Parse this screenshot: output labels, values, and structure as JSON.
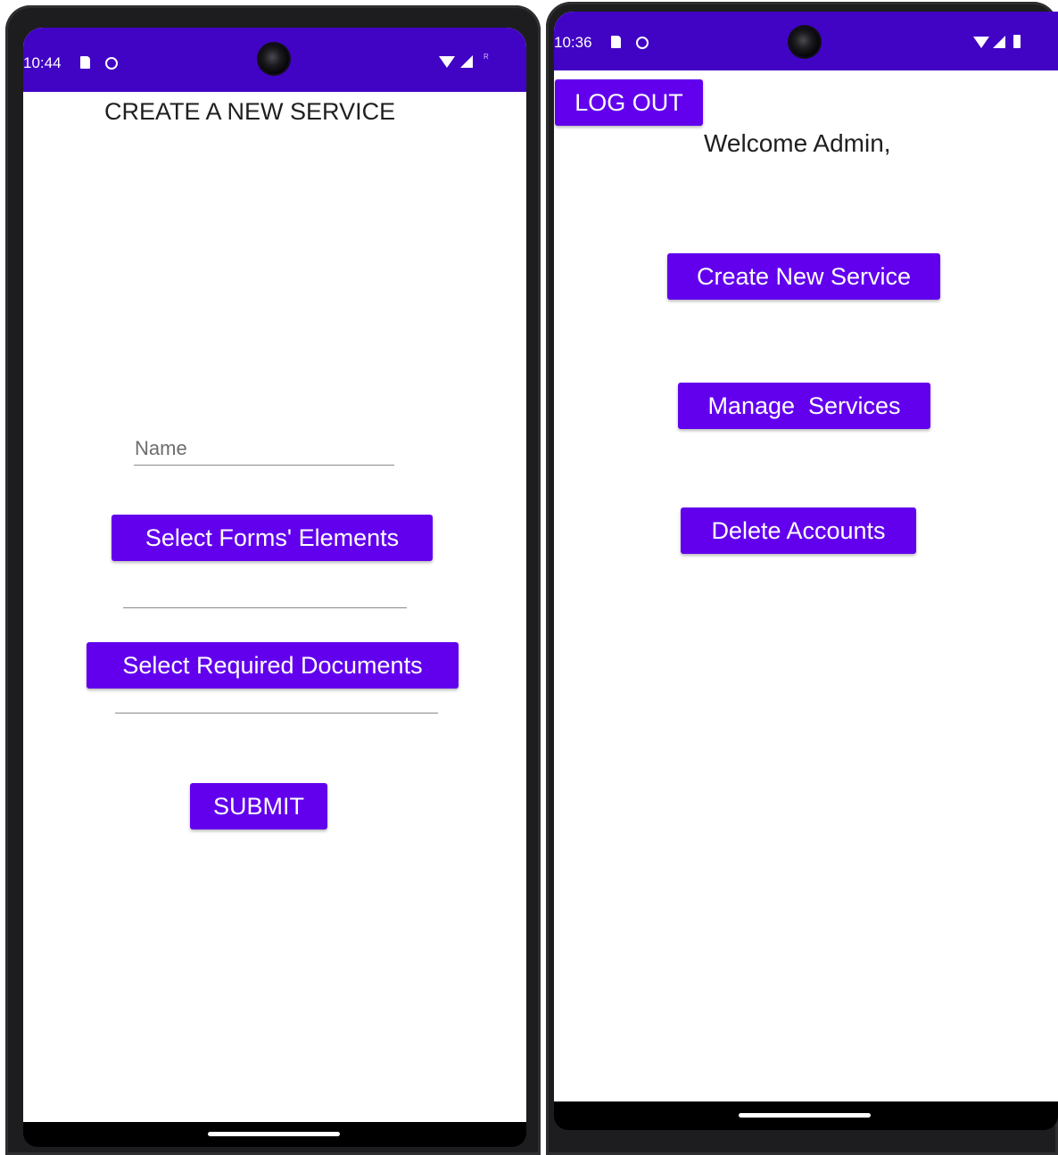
{
  "left_screen": {
    "status": {
      "time": "10:44",
      "indicator": "R"
    },
    "page_title": "CREATE A NEW SERVICE",
    "name_input": {
      "placeholder": "Name",
      "value": ""
    },
    "select_forms_button": "Select Forms' Elements",
    "select_documents_button": "Select Required Documents",
    "submit_button": "SUBMIT"
  },
  "right_screen": {
    "status": {
      "time": "10:36"
    },
    "logout_button": "LOG OUT",
    "welcome_text": "Welcome Admin,",
    "create_service_button": "Create New Service",
    "manage_services_button": "Manage  Services",
    "delete_accounts_button": "Delete Accounts"
  },
  "colors": {
    "status_bar": "#4104c4",
    "button": "#6200ee",
    "button_text": "#ffffff",
    "background": "#ffffff"
  },
  "icons": [
    "sd-card-icon",
    "circle-status-icon",
    "camera-hole",
    "wifi-icon",
    "signal-icon",
    "battery-icon"
  ]
}
